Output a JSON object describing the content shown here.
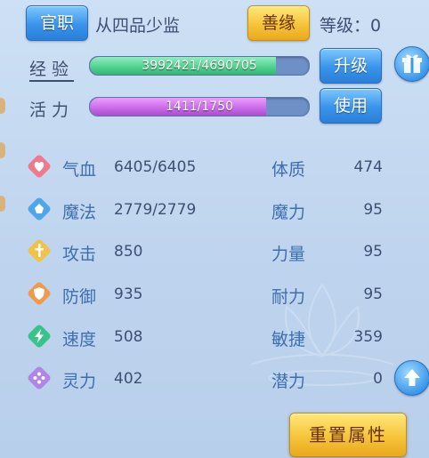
{
  "header": {
    "official_button_label": "官职",
    "official_rank": "从四品少监",
    "karma_button_label": "善缘",
    "level_label": "等级：",
    "level_value": "0"
  },
  "experience": {
    "label": "经验",
    "text": "3992421/4690705",
    "current": 3992421,
    "max": 4690705,
    "upgrade_label": "升级",
    "fill_color": "#4fcf8e"
  },
  "vitality": {
    "label": "活力",
    "text": "1411/1750",
    "current": 1411,
    "max": 1750,
    "use_label": "使用",
    "fill_color": "#c86ae6"
  },
  "stats": [
    {
      "icon": "heart-icon",
      "name": "气血",
      "value": "6405/6405",
      "attr_name": "体质",
      "attr_value": "474",
      "color": "#ef7a8e"
    },
    {
      "icon": "magic-icon",
      "name": "魔法",
      "value": "2779/2779",
      "attr_name": "魔力",
      "attr_value": "95",
      "color": "#4fa6e8"
    },
    {
      "icon": "sword-icon",
      "name": "攻击",
      "value": "850",
      "attr_name": "力量",
      "attr_value": "95",
      "color": "#f1c24a"
    },
    {
      "icon": "shield-icon",
      "name": "防御",
      "value": "935",
      "attr_name": "耐力",
      "attr_value": "95",
      "color": "#f09a4a"
    },
    {
      "icon": "lightning-icon",
      "name": "速度",
      "value": "508",
      "attr_name": "敏捷",
      "attr_value": "359",
      "color": "#37c48a"
    },
    {
      "icon": "spirit-icon",
      "name": "灵力",
      "value": "402",
      "attr_name": "潜力",
      "attr_value": "0",
      "color": "#b085e8"
    }
  ],
  "reset_label": "重置属性",
  "gift_icon": "gift-icon",
  "up_arrow_icon": "up-arrow-icon"
}
